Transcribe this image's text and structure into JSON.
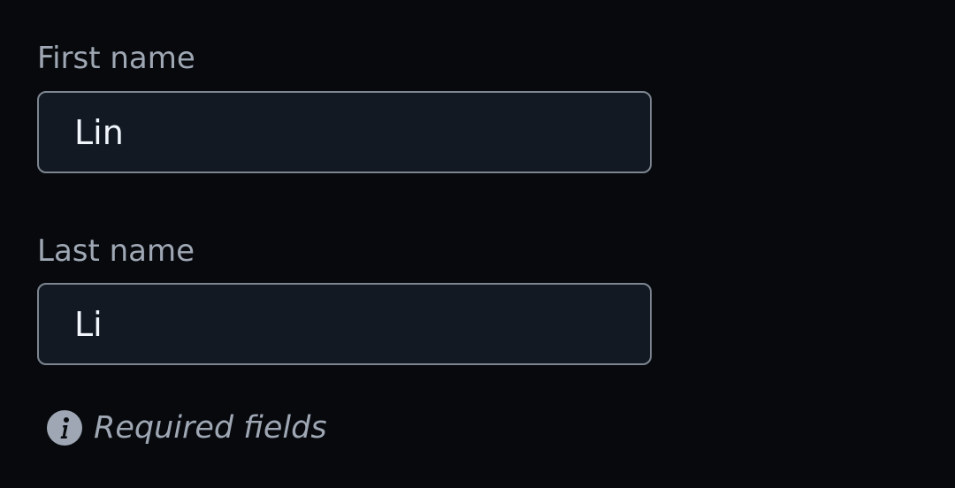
{
  "form": {
    "first_name": {
      "label": "First name",
      "value": "Lin"
    },
    "last_name": {
      "label": "Last name",
      "value": "Li"
    },
    "hint": {
      "icon": "info-icon",
      "text": "Required fields"
    }
  },
  "colors": {
    "background": "#07090d",
    "input_background": "#131922",
    "input_border": "#7d8590",
    "label_text": "#9ea7b3",
    "input_text": "#f0f6fc"
  }
}
